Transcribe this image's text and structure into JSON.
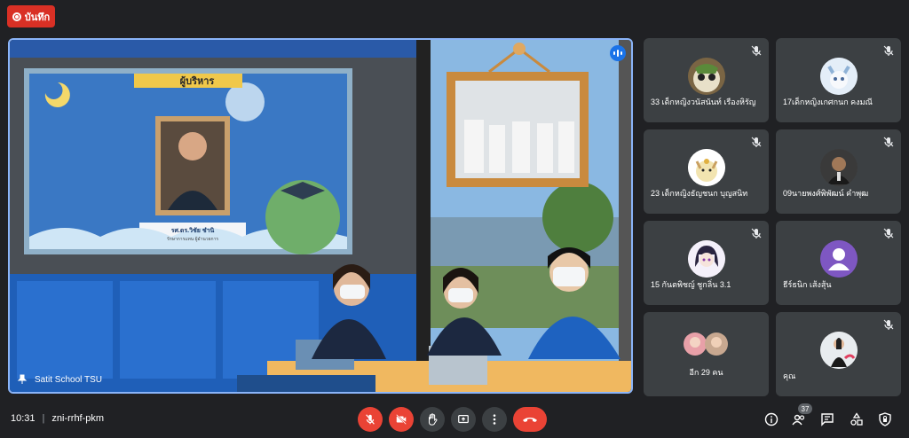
{
  "record": {
    "label": "บันทึก"
  },
  "main_video": {
    "presenter_name": "Satit School TSU",
    "slide_header": "ผู้บริหาร",
    "caption_name": "รศ.ดร.วิชัย ชำนิ",
    "caption_role": "รักษาการแทน ผู้อำนวยการ"
  },
  "participants": [
    {
      "name": "33 เด็กหญิงวนัสนันท์ เรืองหิรัญ",
      "avatar": "owl-avatar-icon",
      "muted": true
    },
    {
      "name": "17เด็กหญิงเกศกนก คงมณี",
      "avatar": "eevee-avatar-icon",
      "muted": true
    },
    {
      "name": "23 เด็กหญิงธัญชนก บุญสนิท",
      "avatar": "meowth-avatar-icon",
      "muted": true
    },
    {
      "name": "09นายพงศ์พิพัฒน์ คำพุฒ",
      "avatar": "person-photo-avatar",
      "muted": true
    },
    {
      "name": "15 กันตพิชญ์ ชูกลิ่น 3.1",
      "avatar": "anime-girl-avatar",
      "muted": true
    },
    {
      "name": "ธีร์ธนิก เส้งสุ้น",
      "avatar": "default-person-avatar-icon",
      "muted": true
    },
    {
      "name": "อีก 29 คน",
      "avatar": "group-avatars",
      "muted": false
    },
    {
      "name": "คุณ",
      "avatar": "self-photo-avatar",
      "muted": true
    }
  ],
  "bottom_bar": {
    "time": "10:31",
    "meeting_code": "zni-rrhf-pkm",
    "participant_count": "37"
  },
  "colors": {
    "accent": "#8ab4f8",
    "danger": "#ea4335",
    "background": "#202124",
    "tile": "#3c4043"
  }
}
